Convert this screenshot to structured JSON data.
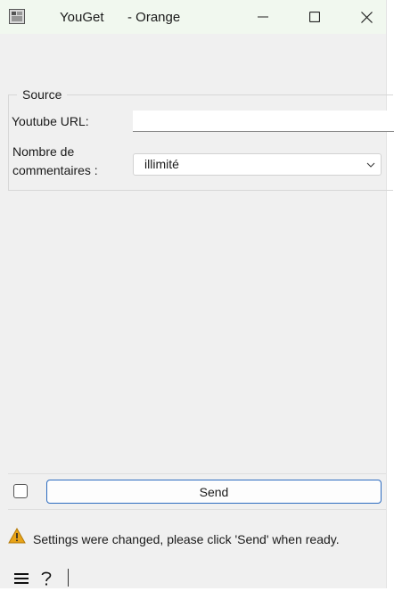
{
  "window": {
    "title": "YouGet",
    "title_suffix": "- Orange",
    "controls": {
      "minimize": "minimize-icon",
      "maximize": "maximize-icon",
      "close": "close-icon"
    }
  },
  "source": {
    "legend": "Source",
    "url_label": "Youtube URL:",
    "url_value": "",
    "url_placeholder": "",
    "comments_label": "Nombre de\ncommentaires :",
    "comments_value": "illimité"
  },
  "footer": {
    "send_label": "Send",
    "auto_send_checked": false,
    "status": "Settings were changed, please click 'Send' when ready.",
    "warning_color": "#e8a317",
    "icons": [
      "menu-icon",
      "help-icon"
    ]
  },
  "colors": {
    "titlebar_bg": "#f1f8ef",
    "window_bg": "#f0f0f0",
    "accent": "#2d6cc0"
  }
}
